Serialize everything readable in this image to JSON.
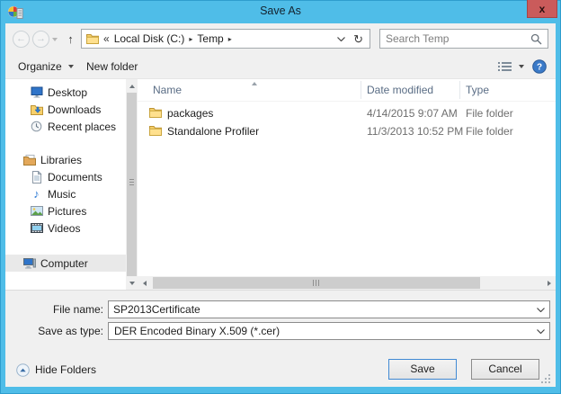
{
  "window": {
    "title": "Save As",
    "close_glyph": "x"
  },
  "navbar": {
    "back_glyph": "←",
    "forward_glyph": "→",
    "up_glyph": "↑",
    "refresh_glyph": "↻",
    "breadcrumb": {
      "overflow": "«",
      "crumbs": [
        "Local Disk (C:)",
        "Temp"
      ],
      "separator": "▸"
    },
    "search": {
      "placeholder": "Search Temp"
    }
  },
  "toolbar": {
    "organize": "Organize",
    "new_folder": "New folder"
  },
  "sidebar": {
    "items": [
      {
        "icon": "desktop-icon",
        "label": "Desktop"
      },
      {
        "icon": "downloads-icon",
        "label": "Downloads"
      },
      {
        "icon": "recent-places-icon",
        "label": "Recent places"
      },
      {
        "icon": "libraries-icon",
        "label": "Libraries"
      },
      {
        "icon": "documents-icon",
        "label": "Documents"
      },
      {
        "icon": "music-icon",
        "label": "Music"
      },
      {
        "icon": "pictures-icon",
        "label": "Pictures"
      },
      {
        "icon": "videos-icon",
        "label": "Videos"
      },
      {
        "icon": "computer-icon",
        "label": "Computer",
        "selected": true
      }
    ]
  },
  "filelist": {
    "columns": [
      "Name",
      "Date modified",
      "Type"
    ],
    "rows": [
      {
        "name": "packages",
        "date": "4/14/2015 9:07 AM",
        "type": "File folder"
      },
      {
        "name": "Standalone Profiler",
        "date": "11/3/2013 10:52 PM",
        "type": "File folder"
      }
    ]
  },
  "fields": {
    "file_name_label": "File name:",
    "file_name_value": "SP2013Certificate",
    "save_as_type_label": "Save as type:",
    "save_as_type_value": "DER Encoded Binary X.509 (*.cer)"
  },
  "footer": {
    "hide_folders": "Hide Folders",
    "save": "Save",
    "cancel": "Cancel"
  },
  "icons": {
    "search-icon": "magnifier",
    "help-icon": "blue-circle-question-mark",
    "view-list-icon": "list-lines",
    "folder-icon": "manila-folder",
    "music-note-glyph": "♪"
  },
  "colors": {
    "titlebar": "#4fbde8",
    "close_button": "#ca5b5b",
    "default_button_border": "#418ad4",
    "column_header_text": "#5a6d85",
    "selection": "#e9e9e9"
  }
}
